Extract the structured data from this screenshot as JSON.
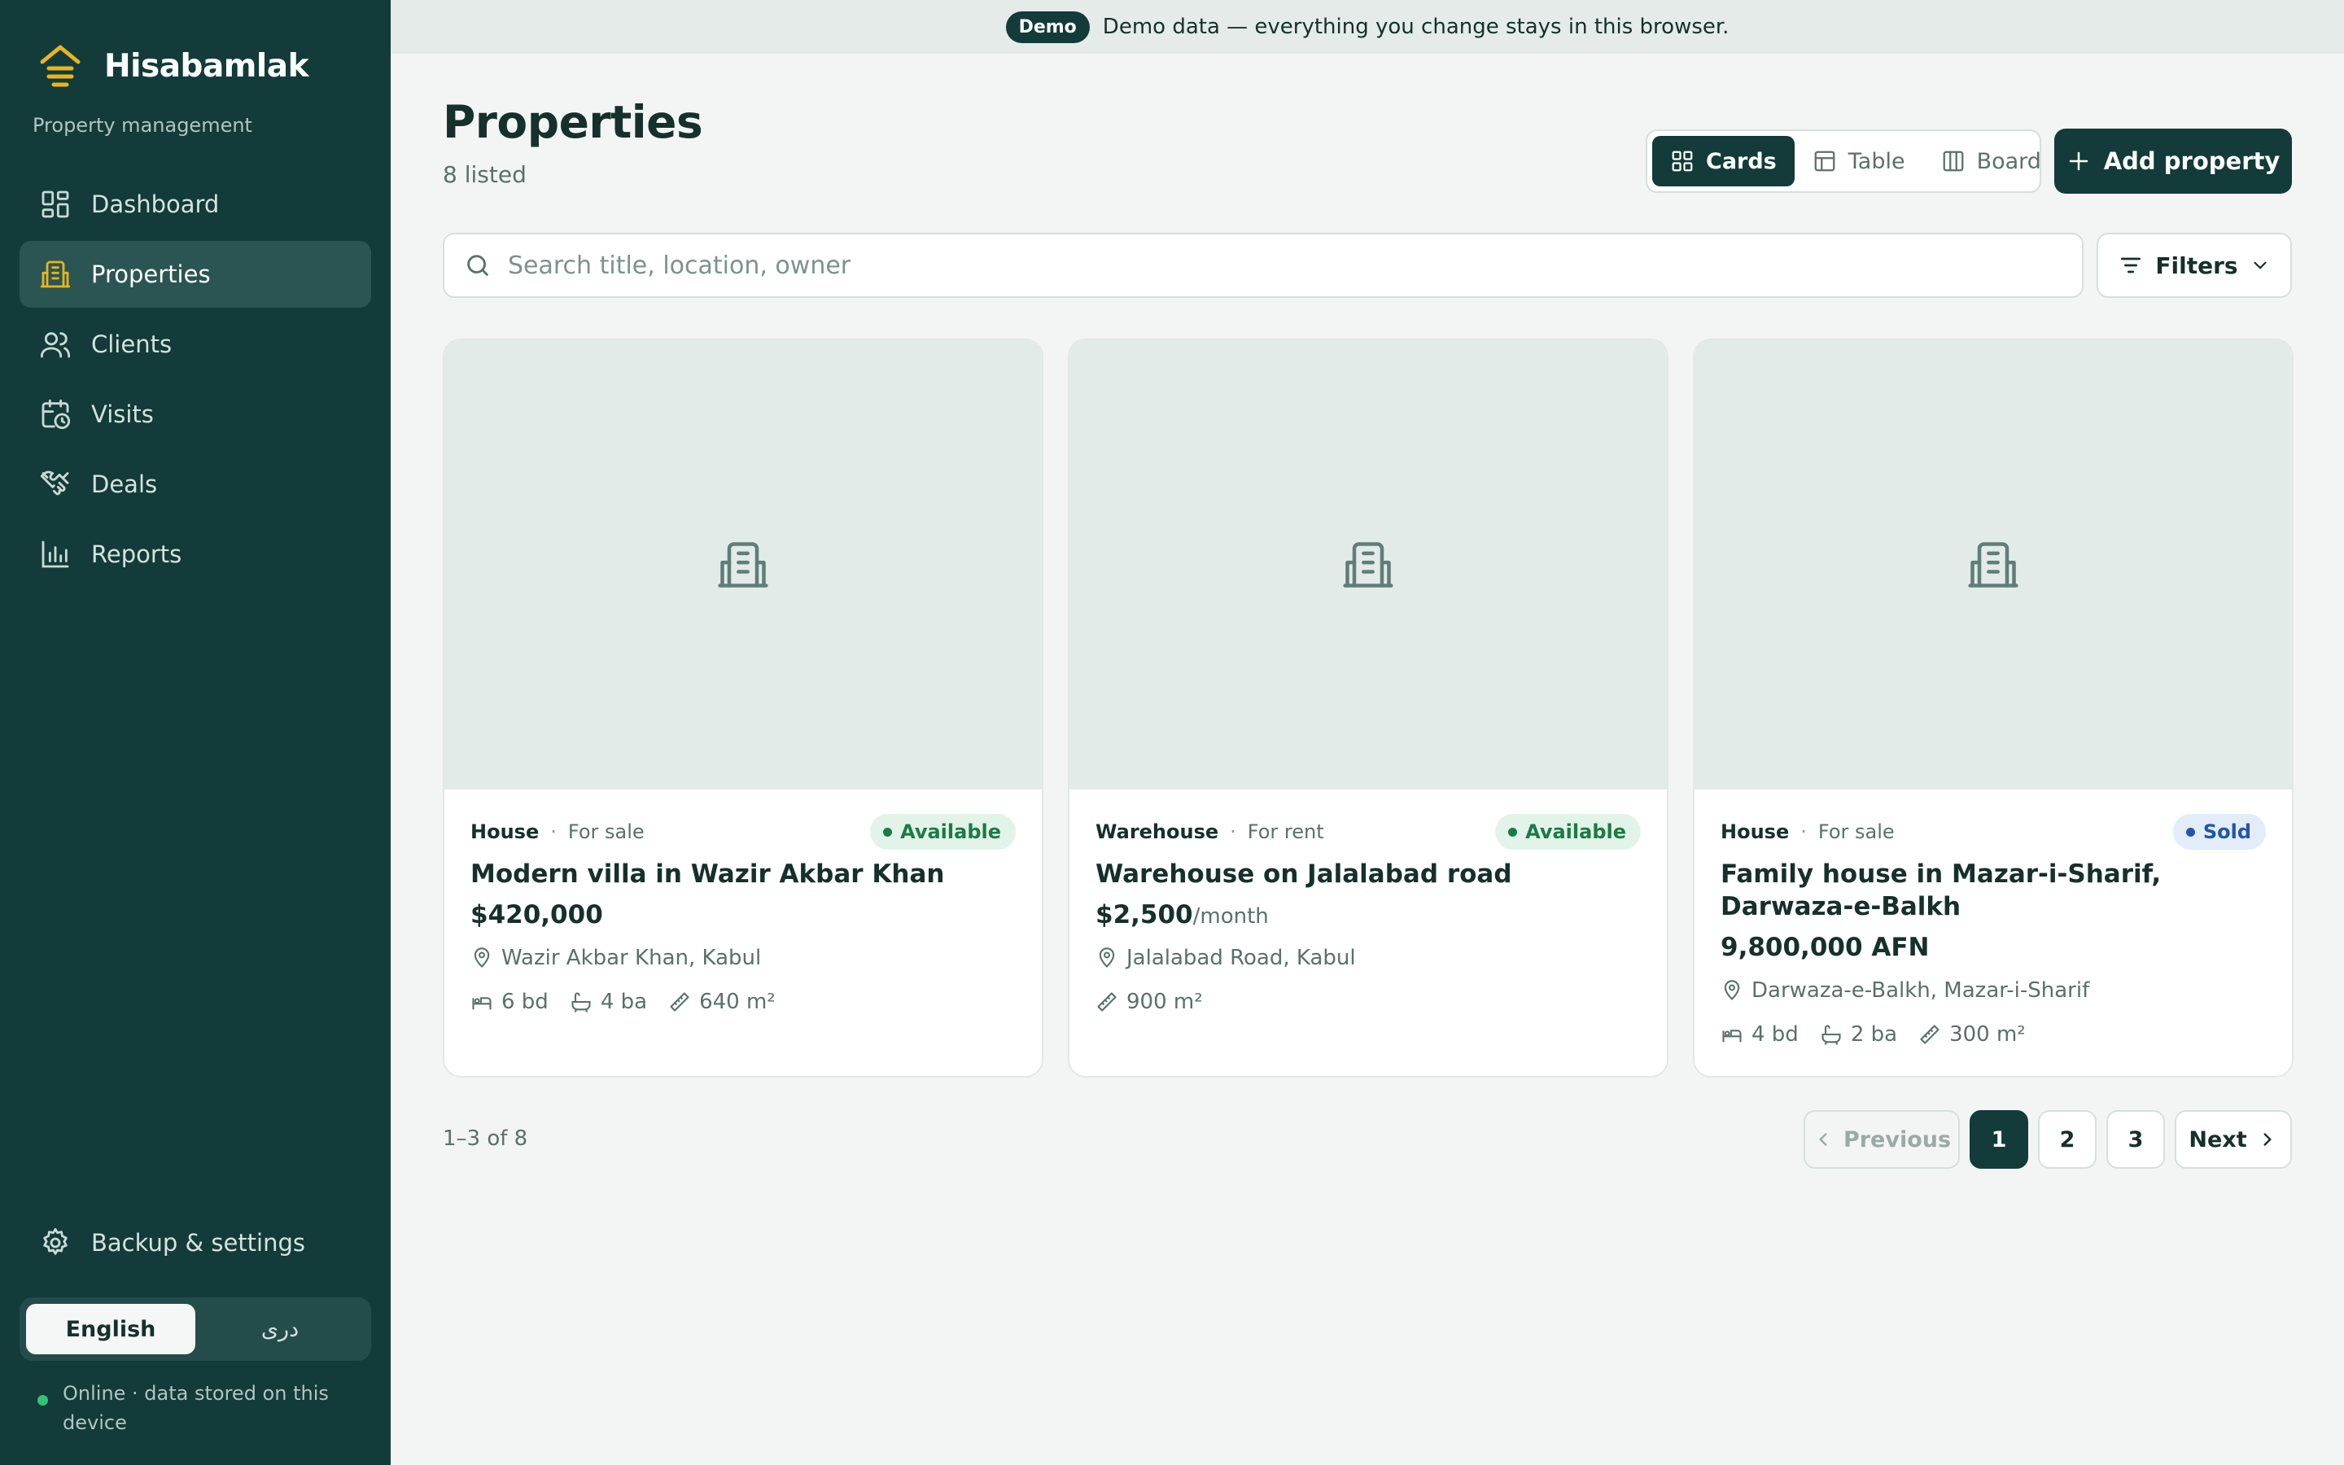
{
  "app": {
    "name": "Hisabamlak",
    "subtitle": "Property management"
  },
  "banner": {
    "badge": "Demo",
    "text": "Demo data — everything you change stays in this browser."
  },
  "sidebar": {
    "items": [
      {
        "label": "Dashboard",
        "icon": "dashboard-icon"
      },
      {
        "label": "Properties",
        "icon": "building-icon",
        "active": true
      },
      {
        "label": "Clients",
        "icon": "users-icon"
      },
      {
        "label": "Visits",
        "icon": "calendar-clock-icon"
      },
      {
        "label": "Deals",
        "icon": "handshake-icon"
      },
      {
        "label": "Reports",
        "icon": "bar-chart-icon"
      }
    ],
    "settings_label": "Backup & settings",
    "languages": [
      "English",
      "دری"
    ],
    "active_language": "English",
    "status_text": "Online · data stored on this device"
  },
  "page": {
    "title": "Properties",
    "count_text": "8 listed"
  },
  "view_toggle": {
    "options": [
      "Cards",
      "Table",
      "Board"
    ],
    "active": "Cards"
  },
  "add_button_label": "Add property",
  "search": {
    "placeholder": "Search title, location, owner",
    "value": ""
  },
  "filters_label": "Filters",
  "properties": [
    {
      "type": "House",
      "listing": "For sale",
      "status": "Available",
      "title": "Modern villa in Wazir Akbar Khan",
      "price": "$420,000",
      "price_suffix": "",
      "location": "Wazir Akbar Khan, Kabul",
      "beds": "6 bd",
      "baths": "4 ba",
      "area": "640 m²"
    },
    {
      "type": "Warehouse",
      "listing": "For rent",
      "status": "Available",
      "title": "Warehouse on Jalalabad road",
      "price": "$2,500",
      "price_suffix": "/month",
      "location": "Jalalabad Road, Kabul",
      "beds": "",
      "baths": "",
      "area": "900 m²"
    },
    {
      "type": "House",
      "listing": "For sale",
      "status": "Sold",
      "title": "Family house in Mazar-i-Sharif, Darwaza-e-Balkh",
      "price": "9,800,000 AFN",
      "price_suffix": "",
      "location": "Darwaza-e-Balkh, Mazar-i-Sharif",
      "beds": "4 bd",
      "baths": "2 ba",
      "area": "300 m²"
    }
  ],
  "pagination": {
    "range_text": "1–3 of 8",
    "previous_label": "Previous",
    "next_label": "Next",
    "pages": [
      "1",
      "2",
      "3"
    ],
    "current": "1"
  },
  "colors": {
    "sidebar_bg": "#123b39",
    "accent": "#123b39",
    "brand_yellow": "#e8b420",
    "available_green": "#1c7a47",
    "sold_blue": "#2356a6"
  }
}
